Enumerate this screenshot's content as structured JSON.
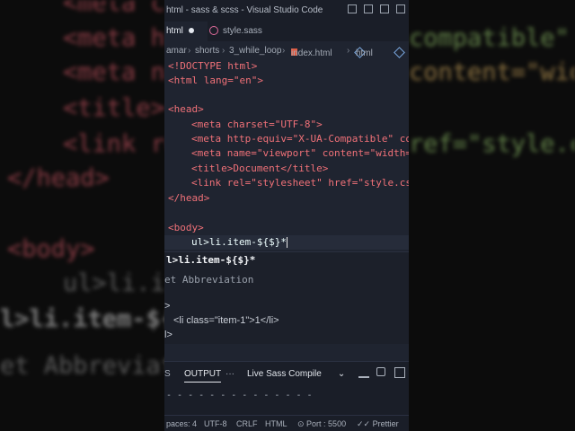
{
  "window": {
    "title": "html - sass & scss - Visual Studio Code"
  },
  "tabs": [
    {
      "label": "html",
      "modified": true,
      "active": true
    },
    {
      "label": "style.sass",
      "active": false
    }
  ],
  "breadcrumb": [
    "amar",
    "shorts",
    "3_while_loop",
    "index.html",
    "html"
  ],
  "code_lines": [
    "<!DOCTYPE html>",
    "<html lang=\"en\">",
    "",
    "<head>",
    "<meta charset=\"UTF-8\">",
    "<meta http-equiv=\"X-UA-Compatible\" co",
    "<meta name=\"viewport\" content=\"width=",
    "<title>Document</title>",
    "<link rel=\"stylesheet\" href=\"style.cs",
    "</head>",
    "",
    "<body>",
    "ul>li.item-${$}*"
  ],
  "suggest": {
    "abbreviation": "l>li.item-${$}*",
    "label": "et Abbreviation",
    "preview": [
      ">",
      "<li class=\"item-1\">1</li>",
      "l>"
    ]
  },
  "bottom_panel": {
    "tabs": [
      "S",
      "OUTPUT",
      "···"
    ],
    "output_channel": "Live Sass Compile",
    "dashes": "- - - - - - - - - - - - - -"
  },
  "status_bar": {
    "spaces": "paces: 4",
    "encoding": "UTF-8",
    "eol": "CRLF",
    "language": "HTML",
    "port": "Port : 5500",
    "prettier": "Prettier"
  },
  "background": {
    "lines": [
      "<meta c",
      "<meta ht",
      "compatible\" co",
      "<meta na",
      "content=\"width=",
      "<title>",
      "<link re",
      "ref=\"style.cs",
      "</head>",
      "<body>",
      "ul>li.i",
      "l>li.item-${",
      "et Abbreviat"
    ]
  }
}
